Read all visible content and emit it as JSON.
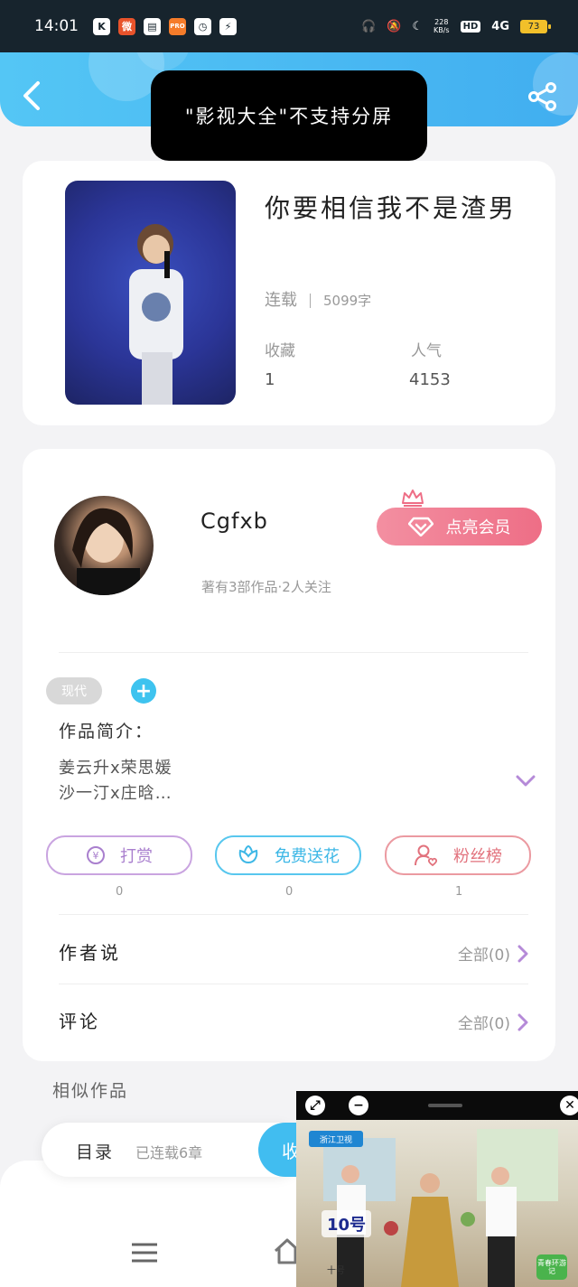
{
  "status_bar": {
    "time": "14:01",
    "net_speed_value": "228",
    "net_speed_unit": "KB/s",
    "hd": "HD",
    "signal": "4G",
    "battery": "73",
    "apps": [
      "K",
      "微",
      "▤",
      "PRO",
      "◷",
      "⚡"
    ]
  },
  "toast": {
    "text": "\"影视大全\"不支持分屏"
  },
  "book": {
    "title": "你要相信我不是渣男",
    "status": "连载",
    "word_count": "5099字",
    "favorites_label": "收藏",
    "favorites_value": "1",
    "popularity_label": "人气",
    "popularity_value": "4153"
  },
  "author": {
    "name": "Cgfxb",
    "info": "著有3部作品·2人关注",
    "vip_button": "点亮会员"
  },
  "tags": [
    "现代"
  ],
  "intro": {
    "label": "作品简介：",
    "line1": "姜云升x荣思媛",
    "line2": "沙一汀x庄晗…"
  },
  "actions": [
    {
      "label": "打赏",
      "count": "0"
    },
    {
      "label": "免费送花",
      "count": "0"
    },
    {
      "label": "粉丝榜",
      "count": "1"
    }
  ],
  "author_says": {
    "label": "作者说",
    "link": "全部(0)"
  },
  "comments": {
    "label": "评论",
    "link": "全部(0)"
  },
  "similar": {
    "label": "相似作品"
  },
  "bottom": {
    "toc_label": "目录",
    "toc_status": "已连载6章",
    "collect_partial": "收"
  },
  "pip": {
    "channel_logo": "浙江卫视",
    "contestant_tag": "10号",
    "caption": "十号",
    "corner_logo": "青春环游记"
  },
  "colors": {
    "header_blue": "#41aef0",
    "vip_pink": "#ee6e86",
    "tip_purple": "#a97fce",
    "flower_blue": "#3cb7e6",
    "fans_red": "#e2727d"
  }
}
